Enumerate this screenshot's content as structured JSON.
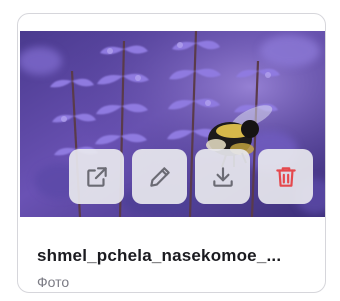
{
  "file": {
    "name": "shmel_pchela_nasekomoe_...",
    "type_label": "Фото"
  },
  "actions": [
    {
      "icon": "external-link-icon"
    },
    {
      "icon": "pencil-icon"
    },
    {
      "icon": "download-icon"
    },
    {
      "icon": "trash-icon"
    }
  ],
  "colors": {
    "icon": "#6b6b74",
    "danger": "#e5484d",
    "button_bg": "#e8e8ee"
  }
}
